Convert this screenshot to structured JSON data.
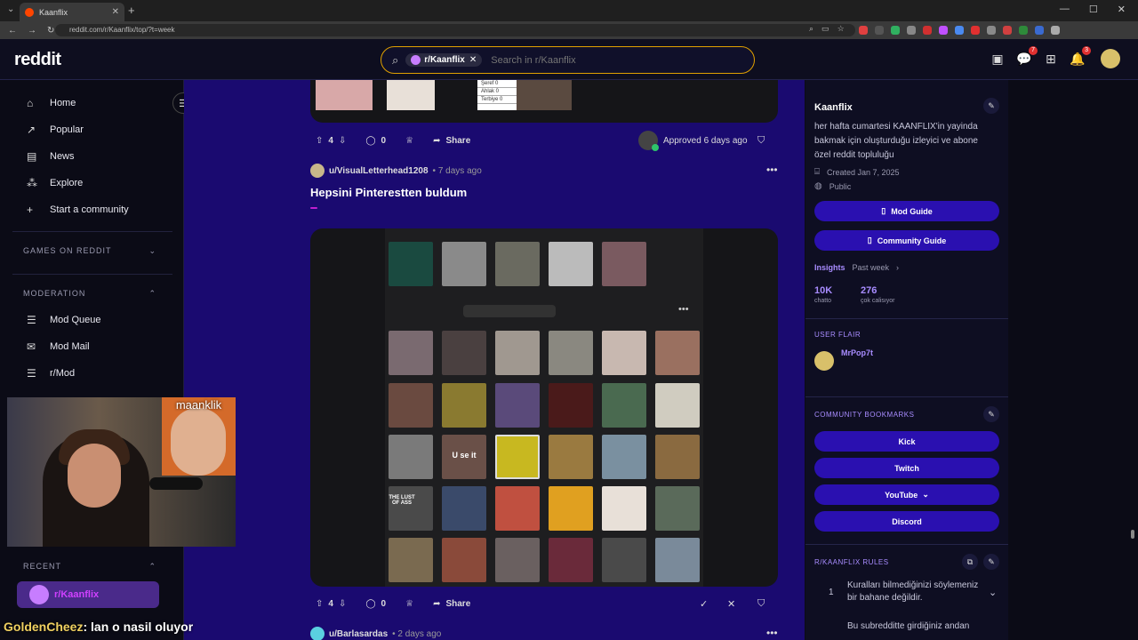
{
  "browser": {
    "tab_title": "Kaanflix",
    "url": "reddit.com/r/Kaanflix/top/?t=week"
  },
  "header": {
    "logo": "reddit",
    "search_chip": "r/Kaanflix",
    "search_placeholder": "Search in r/Kaanflix",
    "chat_badge": "7",
    "notif_badge": "3"
  },
  "sidebar": {
    "items": [
      {
        "label": "Home",
        "icon": "home-icon"
      },
      {
        "label": "Popular",
        "icon": "popular-icon"
      },
      {
        "label": "News",
        "icon": "news-icon"
      },
      {
        "label": "Explore",
        "icon": "explore-icon"
      },
      {
        "label": "Start a community",
        "icon": "plus-icon"
      }
    ],
    "games_label": "GAMES ON REDDIT",
    "moderation_label": "MODERATION",
    "mod_items": [
      {
        "label": "Mod Queue"
      },
      {
        "label": "Mod Mail"
      },
      {
        "label": "r/Mod"
      }
    ],
    "recent_label": "RECENT",
    "recent_item": "r/Kaanflix"
  },
  "webcam": {
    "inset_label": "maanklik"
  },
  "chat": {
    "user": "GoldenCheez",
    "message": ": lan o nasil oluyor"
  },
  "post1": {
    "top_thumbs": [
      "Şeref 0",
      "Ahlak 0",
      "Terbiye 0"
    ],
    "votes": "4",
    "comments": "0",
    "share": "Share",
    "approved": "Approved 6 days ago"
  },
  "post2": {
    "user": "u/VisualLetterhead1208",
    "time": "• 7 days ago",
    "title": "Hepsini Pinterestten buldum",
    "flair": "",
    "cell_label": "U se it",
    "cell_text2": "THE LUST OF ASS",
    "votes": "4",
    "comments": "0",
    "share": "Share"
  },
  "post3": {
    "user": "u/Barlasardas",
    "time": "• 2 days ago"
  },
  "community": {
    "name": "Kaanflix",
    "description": "her hafta cumartesi KAANFLIX'in yayinda bakmak için oluşturduğu izleyici ve abone özel reddit topluluğu",
    "created": "Created Jan 7, 2025",
    "visibility": "Public",
    "mod_guide": "Mod Guide",
    "community_guide": "Community Guide",
    "insights": "Insights",
    "insights_period": "Past week",
    "stat1_value": "10K",
    "stat1_label": "chatto",
    "stat2_value": "276",
    "stat2_label": "çok calisıyor",
    "user_flair_label": "USER FLAIR",
    "user_flair_name": "MrPop7t",
    "user_flair_tag": "",
    "bookmarks_label": "COMMUNITY BOOKMARKS",
    "bookmarks": [
      "Kick",
      "Twitch",
      "YouTube",
      "Discord"
    ],
    "rules_label": "R/KAANFLIX RULES",
    "rules": [
      {
        "num": "1",
        "text": "Kuralları bilmediğinizi söylemeniz bir bahane değildir."
      },
      {
        "num": "",
        "text": "Bu subredditte girdiğiniz andan"
      }
    ]
  },
  "colors": {
    "feed_bg": "#1a0a70",
    "button_bg": "#2a10b0",
    "accent": "#a88cff",
    "search_border": "#e0a000"
  }
}
